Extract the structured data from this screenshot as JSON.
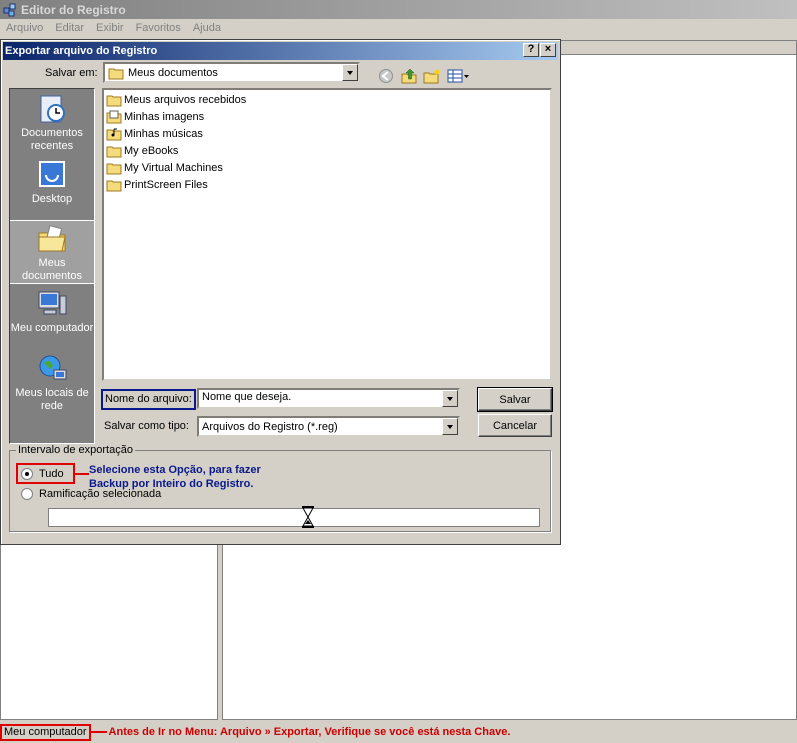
{
  "main_window": {
    "title": "Editor do Registro",
    "menu": [
      "Arquivo",
      "Editar",
      "Exibir",
      "Favoritos",
      "Ajuda"
    ],
    "status_text": "Meu computador",
    "status_note": "Antes de Ir no Menu: Arquivo » Exportar, Verifique se você está nesta Chave."
  },
  "dialog": {
    "title": "Exportar arquivo do Registro",
    "help_label": "?",
    "close_label": "×",
    "save_in_label": "Salvar em:",
    "save_in_value": "Meus documentos",
    "places": [
      {
        "label": "Documentos recentes",
        "icon": "recent-documents-icon"
      },
      {
        "label": "Desktop",
        "icon": "desktop-icon"
      },
      {
        "label": "Meus documentos",
        "icon": "my-documents-icon",
        "selected": true
      },
      {
        "label": "Meu computador",
        "icon": "my-computer-icon"
      },
      {
        "label": "Meus locais de rede",
        "icon": "network-places-icon"
      }
    ],
    "files": [
      "Meus arquivos recebidos",
      "Minhas imagens",
      "Minhas músicas",
      "My eBooks",
      "My Virtual Machines",
      "PrintScreen Files"
    ],
    "filename_label": "Nome do arquivo:",
    "filename_value": "Nome que deseja.",
    "filetype_label": "Salvar como tipo:",
    "filetype_value": "Arquivos do Registro (*.reg)",
    "save_button": "Salvar",
    "cancel_button": "Cancelar",
    "export_range": {
      "title": "Intervalo de exportação",
      "option_all": "Tudo",
      "option_branch": "Ramificação selecionada",
      "annotation_line1": "Selecione esta Opção, para fazer",
      "annotation_line2": "Backup por Inteiro do Registro."
    }
  },
  "colors": {
    "title_active": "#0a246a",
    "annotation_red": "#e00000",
    "annotation_blue": "#0a1a8c"
  }
}
